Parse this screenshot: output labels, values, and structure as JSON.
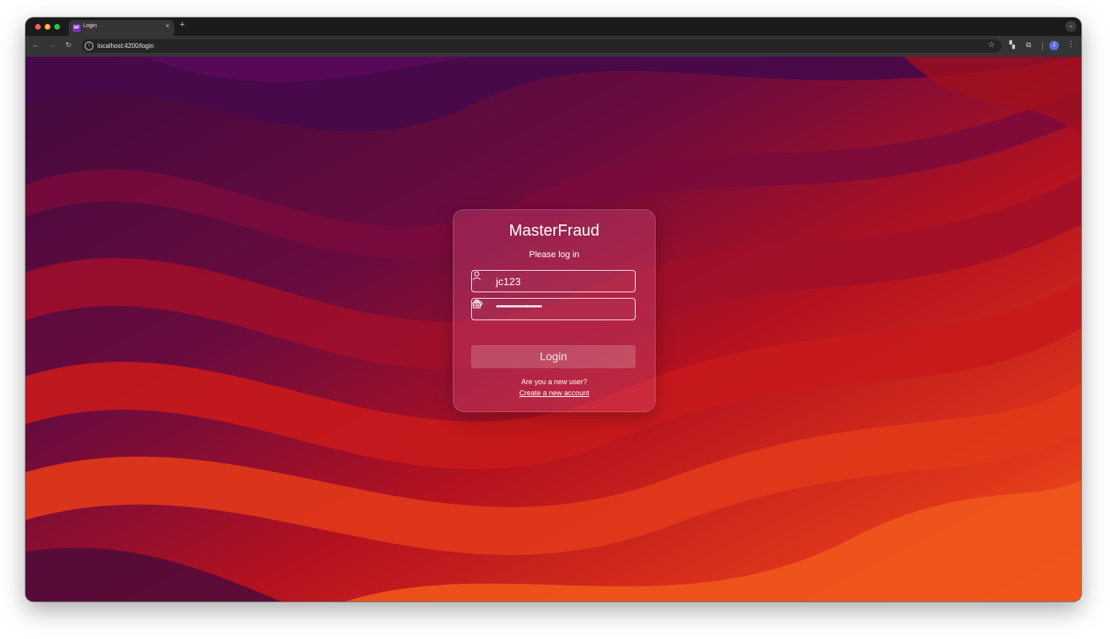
{
  "browser": {
    "tab_title": "Login",
    "tab_favicon": "MF",
    "new_tab_label": "+",
    "close_tab_label": "×",
    "url": "localhost:4200/login",
    "profile_initial": "J"
  },
  "login": {
    "brand": "MasterFraud",
    "subtitle": "Please log in",
    "username_value": "jc123",
    "password_mask": "••••••••••••••••••••",
    "button_label": "Login",
    "new_user_prompt": "Are you a new user?",
    "create_account_link": "Create a new account"
  },
  "colors": {
    "background_purple": "#4a0a45",
    "background_red": "#c8161c",
    "background_orange": "#f0531c",
    "card_tint": "#d7507d"
  },
  "icons": [
    "user-icon",
    "lock-icon",
    "eye-icon",
    "star-icon",
    "reload-icon",
    "back-icon",
    "forward-icon"
  ]
}
